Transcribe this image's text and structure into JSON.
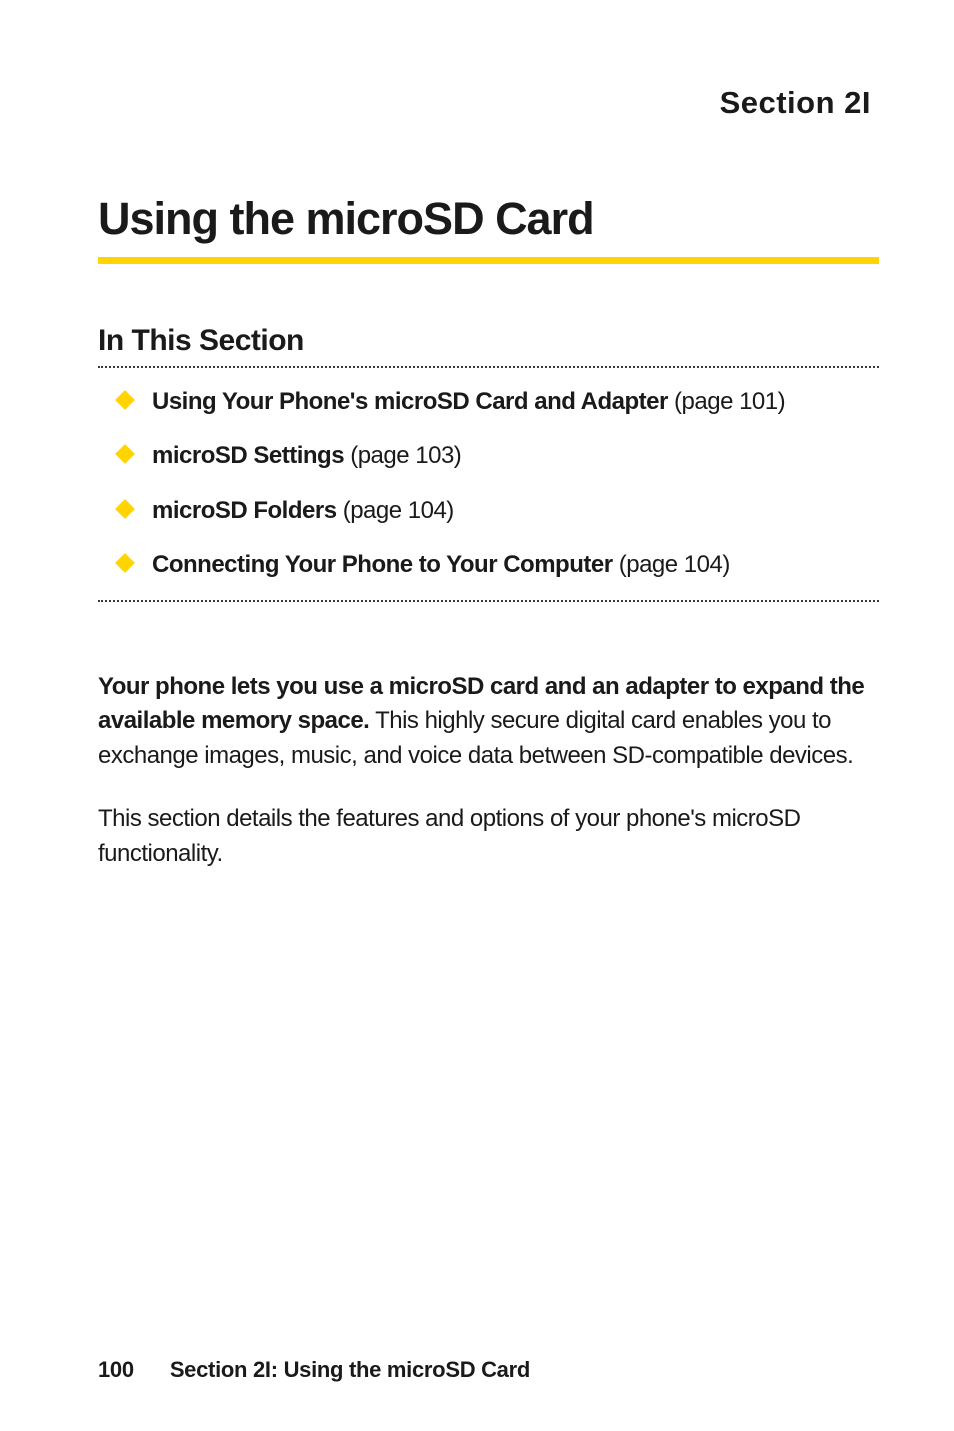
{
  "header": {
    "section_label": "Section 2I"
  },
  "title": "Using the microSD Card",
  "subheading": "In This Section",
  "toc": [
    {
      "bold": "Using Your Phone's microSD Card and Adapter",
      "suffix": " (page 101)"
    },
    {
      "bold": "microSD Settings",
      "suffix": " (page 103)"
    },
    {
      "bold": "microSD Folders",
      "suffix": " (page 104)"
    },
    {
      "bold": "Connecting Your Phone to Your Computer",
      "suffix": " (page 104)"
    }
  ],
  "paragraphs": [
    {
      "bold": "Your phone lets you use a microSD card and an adapter to expand the available memory space.",
      "rest": " This highly secure digital card enables you to exchange images, music, and voice data between SD-compatible devices."
    },
    {
      "bold": "",
      "rest": "This section details the features and options of your phone's microSD functionality."
    }
  ],
  "footer": {
    "page_number": "100",
    "text": "Section 2I: Using the microSD Card"
  }
}
